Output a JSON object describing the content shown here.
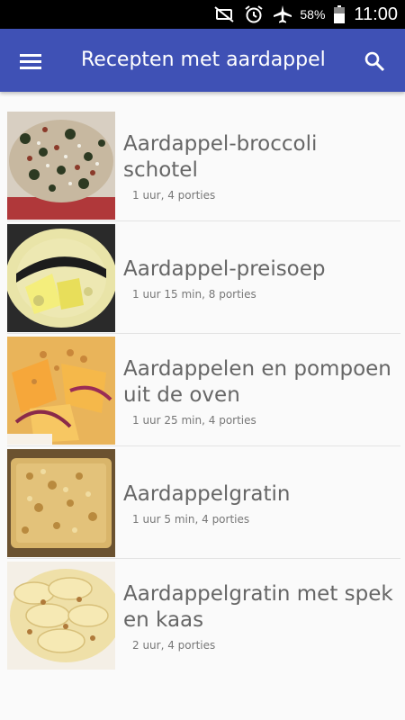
{
  "status_bar": {
    "battery_percent": "58%",
    "time": "11:00",
    "icons": [
      "mute-icon",
      "alarm-icon",
      "airplane-icon",
      "battery-icon"
    ]
  },
  "app_bar": {
    "title": "Recepten met aardappel",
    "menu_icon": "hamburger-menu-icon",
    "search_icon": "search-icon",
    "color": "#3f51b5"
  },
  "recipes": [
    {
      "title": "Aardappel-broccoli schotel",
      "meta": "1 uur, 4 porties"
    },
    {
      "title": "Aardappel-preisoep",
      "meta": "1 uur 15 min, 8 porties"
    },
    {
      "title": "Aardappelen en pompoen uit de oven",
      "meta": "1 uur 25 min, 4 porties"
    },
    {
      "title": "Aardappelgratin",
      "meta": "1 uur 5 min, 4 porties"
    },
    {
      "title": "Aardappelgratin met spek en kaas",
      "meta": "2 uur, 4 porties"
    }
  ]
}
